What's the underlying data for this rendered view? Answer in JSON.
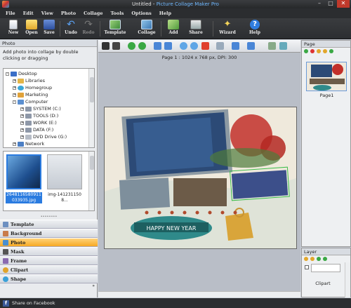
{
  "window": {
    "title_doc": "Untitled - ",
    "title_app": "Picture Collage Maker Pro",
    "minimize": "–",
    "maximize": "□",
    "close": "✕"
  },
  "menu": [
    "File",
    "Edit",
    "View",
    "Photo",
    "Collage",
    "Tools",
    "Options",
    "Help"
  ],
  "toolbar": [
    {
      "label": "New",
      "icon": "new-file-icon",
      "enabled": true
    },
    {
      "label": "Open",
      "icon": "open-folder-icon",
      "enabled": true
    },
    {
      "label": "Save",
      "icon": "save-disk-icon",
      "enabled": true
    },
    {
      "label": "Undo",
      "icon": "undo-icon",
      "enabled": true
    },
    {
      "label": "Redo",
      "icon": "redo-icon",
      "enabled": false
    },
    {
      "label": "Template",
      "icon": "template-icon",
      "enabled": true
    },
    {
      "label": "Collage",
      "icon": "collage-icon",
      "enabled": true
    },
    {
      "label": "Add",
      "icon": "add-photo-icon",
      "enabled": true
    },
    {
      "label": "Share",
      "icon": "share-print-icon",
      "enabled": true
    },
    {
      "label": "Wizard",
      "icon": "wizard-wand-icon",
      "enabled": true
    },
    {
      "label": "Help",
      "icon": "help-icon",
      "enabled": true
    }
  ],
  "left_panel": {
    "header": "Photo",
    "hint": "Add photo into collage by double clicking or dragging",
    "tree": [
      {
        "label": "Desktop",
        "level": 0,
        "icon": "desktop-icon",
        "toggle": "-"
      },
      {
        "label": "Libraries",
        "level": 1,
        "icon": "libraries-icon",
        "toggle": "+"
      },
      {
        "label": "Homegroup",
        "level": 1,
        "icon": "homegroup-icon",
        "toggle": "+"
      },
      {
        "label": "Marketing",
        "level": 1,
        "icon": "user-folder-icon",
        "toggle": "+"
      },
      {
        "label": "Computer",
        "level": 1,
        "icon": "computer-icon",
        "toggle": "-"
      },
      {
        "label": "SYSTEM (C:)",
        "level": 2,
        "icon": "drive-icon",
        "toggle": "+"
      },
      {
        "label": "TOOLS (D:)",
        "level": 2,
        "icon": "drive-icon",
        "toggle": "+"
      },
      {
        "label": "WORK (E:)",
        "level": 2,
        "icon": "drive-icon",
        "toggle": "+"
      },
      {
        "label": "DATA (F:)",
        "level": 2,
        "icon": "drive-icon",
        "toggle": "+"
      },
      {
        "label": "DVD Drive (G:)",
        "level": 2,
        "icon": "dvd-drive-icon",
        "toggle": "+"
      },
      {
        "label": "Network",
        "level": 1,
        "icon": "network-icon",
        "toggle": "+"
      }
    ],
    "photos": [
      {
        "caption": "2648116580911033935.jpg",
        "selected": true
      },
      {
        "caption": "img-1412311508...",
        "selected": false
      }
    ],
    "accordion": [
      {
        "label": "Template",
        "icon": "template-icon",
        "active": false
      },
      {
        "label": "Background",
        "icon": "background-icon",
        "active": false
      },
      {
        "label": "Photo",
        "icon": "photo-icon",
        "active": true
      },
      {
        "label": "Mask",
        "icon": "mask-icon",
        "active": false
      },
      {
        "label": "Frame",
        "icon": "frame-icon",
        "active": false
      },
      {
        "label": "Clipart",
        "icon": "clipart-icon",
        "active": false
      },
      {
        "label": "Shape",
        "icon": "shape-icon",
        "active": false
      }
    ],
    "more": "»"
  },
  "canvas": {
    "page_info": "Page 1 : 1024 x 768 px, DPI: 300",
    "banner_text": "HAPPY NEW YEAR",
    "colors": {
      "ribbon": "#2f8a8a",
      "bow": "#c2302a",
      "gold": "#d9a53a"
    }
  },
  "page_panel": {
    "header": "Page",
    "page_label": "Page1"
  },
  "layer_panel": {
    "header": "Layer",
    "layer_label": "Clipart"
  },
  "status": {
    "text": "Share on Facebook"
  }
}
